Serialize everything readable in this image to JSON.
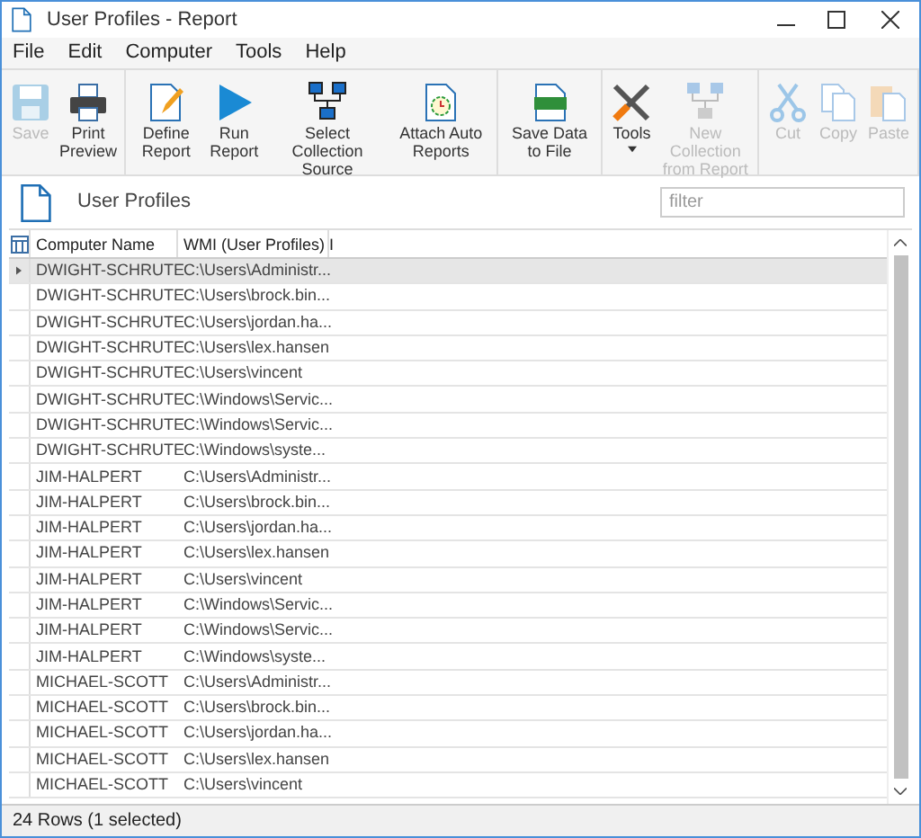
{
  "window": {
    "title": "User Profiles - Report"
  },
  "menu": [
    "File",
    "Edit",
    "Computer",
    "Tools",
    "Help"
  ],
  "toolbar": [
    [
      {
        "label": "Save",
        "disabled": true
      },
      {
        "label": "Print Preview",
        "disabled": false
      }
    ],
    [
      {
        "label": "Define Report",
        "disabled": false
      },
      {
        "label": "Run Report",
        "disabled": false
      },
      {
        "label": "Select Collection Source",
        "disabled": false
      },
      {
        "label": "Attach Auto Reports",
        "disabled": false
      }
    ],
    [
      {
        "label": "Save Data to File",
        "disabled": false
      }
    ],
    [
      {
        "label": "Tools",
        "disabled": false,
        "dropdown": true
      },
      {
        "label": "New Collection from Report",
        "disabled": true
      }
    ],
    [
      {
        "label": "Cut",
        "disabled": true
      },
      {
        "label": "Copy",
        "disabled": true
      },
      {
        "label": "Paste",
        "disabled": true
      }
    ]
  ],
  "report": {
    "title": "User Profiles",
    "filter_placeholder": "filter"
  },
  "table": {
    "columns": [
      "Computer Name",
      "WMI (User Profiles) I"
    ],
    "rows": [
      {
        "cells": [
          "DWIGHT-SCHRUTE",
          "C:\\Users\\Administr..."
        ],
        "selected": true
      },
      {
        "cells": [
          "DWIGHT-SCHRUTE",
          "C:\\Users\\brock.bin..."
        ],
        "selected": false
      },
      {
        "cells": [
          "DWIGHT-SCHRUTE",
          "C:\\Users\\jordan.ha..."
        ],
        "selected": false
      },
      {
        "cells": [
          "DWIGHT-SCHRUTE",
          "C:\\Users\\lex.hansen"
        ],
        "selected": false
      },
      {
        "cells": [
          "DWIGHT-SCHRUTE",
          "C:\\Users\\vincent"
        ],
        "selected": false
      },
      {
        "cells": [
          "DWIGHT-SCHRUTE",
          "C:\\Windows\\Servic..."
        ],
        "selected": false
      },
      {
        "cells": [
          "DWIGHT-SCHRUTE",
          "C:\\Windows\\Servic..."
        ],
        "selected": false
      },
      {
        "cells": [
          "DWIGHT-SCHRUTE",
          "C:\\Windows\\syste..."
        ],
        "selected": false
      },
      {
        "cells": [
          "JIM-HALPERT",
          "C:\\Users\\Administr..."
        ],
        "selected": false
      },
      {
        "cells": [
          "JIM-HALPERT",
          "C:\\Users\\brock.bin..."
        ],
        "selected": false
      },
      {
        "cells": [
          "JIM-HALPERT",
          "C:\\Users\\jordan.ha..."
        ],
        "selected": false
      },
      {
        "cells": [
          "JIM-HALPERT",
          "C:\\Users\\lex.hansen"
        ],
        "selected": false
      },
      {
        "cells": [
          "JIM-HALPERT",
          "C:\\Users\\vincent"
        ],
        "selected": false
      },
      {
        "cells": [
          "JIM-HALPERT",
          "C:\\Windows\\Servic..."
        ],
        "selected": false
      },
      {
        "cells": [
          "JIM-HALPERT",
          "C:\\Windows\\Servic..."
        ],
        "selected": false
      },
      {
        "cells": [
          "JIM-HALPERT",
          "C:\\Windows\\syste..."
        ],
        "selected": false
      },
      {
        "cells": [
          "MICHAEL-SCOTT",
          "C:\\Users\\Administr..."
        ],
        "selected": false
      },
      {
        "cells": [
          "MICHAEL-SCOTT",
          "C:\\Users\\brock.bin..."
        ],
        "selected": false
      },
      {
        "cells": [
          "MICHAEL-SCOTT",
          "C:\\Users\\jordan.ha..."
        ],
        "selected": false
      },
      {
        "cells": [
          "MICHAEL-SCOTT",
          "C:\\Users\\lex.hansen"
        ],
        "selected": false
      },
      {
        "cells": [
          "MICHAEL-SCOTT",
          "C:\\Users\\vincent"
        ],
        "selected": false
      }
    ]
  },
  "status_bar": "24 Rows (1 selected)"
}
